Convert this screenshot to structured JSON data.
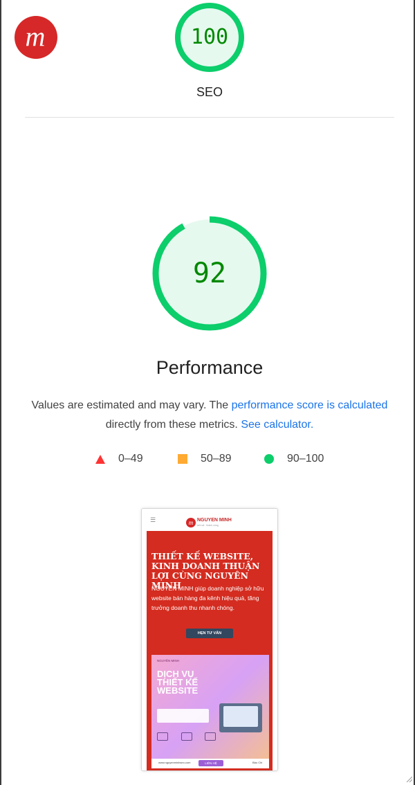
{
  "seo": {
    "score": "100",
    "label": "SEO",
    "score_value": 100
  },
  "performance": {
    "score": "92",
    "score_value": 92,
    "title": "Performance",
    "desc_prefix": "Values are estimated and may vary. The ",
    "link_calculated": "performance score is calculated",
    "desc_middle": " directly from these metrics. ",
    "link_calculator": "See calculator."
  },
  "legend": [
    {
      "label": "0–49",
      "color": "#ff3333",
      "icon": "triangle-icon"
    },
    {
      "label": "50–89",
      "color": "#ffaa33",
      "icon": "square-icon"
    },
    {
      "label": "90–100",
      "color": "#0cce6b",
      "icon": "circle-icon"
    }
  ],
  "colors": {
    "pass_green": "#0cce6b",
    "pass_text": "#008800",
    "link": "#1a73e8",
    "brand_red": "#d42c20"
  },
  "preview": {
    "brand": "NGUYEN MINH",
    "brand_sub": "kết nối · thành công",
    "heading": "THIẾT KẾ WEBSITE, KINH DOANH THUẬN LỢI CÙNG NGUYÊN MINH",
    "paragraph": "NGUYÊN MINH giúp doanh nghiệp sở hữu website bán hàng đa kênh hiệu quả, tăng trưởng doanh thu nhanh chóng.",
    "cta": "HẸN TƯ VẤN",
    "banner_brand": "NGUYÊN MINH",
    "banner_title": "DỊCH VỤ THIẾT KẾ WEBSITE",
    "banner_url": "www.nguyenminhseo.com",
    "banner_contact": "LIÊN HỆ",
    "banner_side": "Bảo Chi"
  }
}
